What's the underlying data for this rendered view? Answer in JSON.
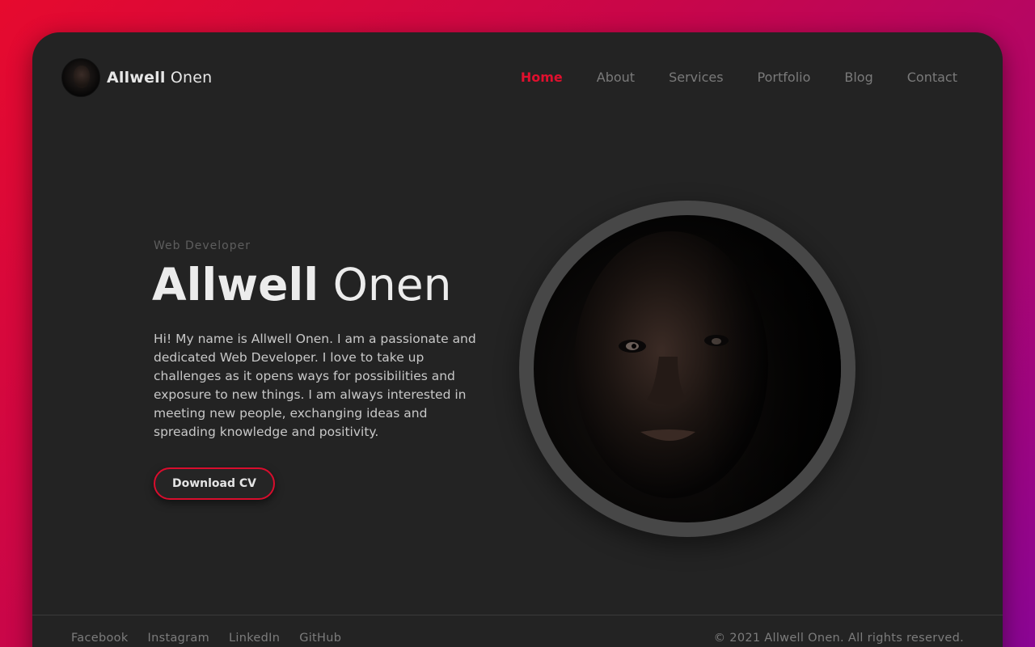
{
  "brand": {
    "first": "Allwell",
    "last": "Onen"
  },
  "nav": {
    "items": [
      {
        "label": "Home",
        "active": true
      },
      {
        "label": "About",
        "active": false
      },
      {
        "label": "Services",
        "active": false
      },
      {
        "label": "Portfolio",
        "active": false
      },
      {
        "label": "Blog",
        "active": false
      },
      {
        "label": "Contact",
        "active": false
      }
    ]
  },
  "hero": {
    "subtitle": "Web Developer",
    "name_first": "Allwell",
    "name_last": "Onen",
    "bio": "Hi! My name is Allwell Onen. I am a passionate and dedicated Web Developer. I love to take up challenges as it opens ways for possibilities and exposure to new things. I am always interested in meeting new people, exchanging ideas and spreading knowledge and positivity.",
    "cta_label": "Download CV"
  },
  "footer": {
    "social": [
      "Facebook",
      "Instagram",
      "LinkedIn",
      "GitHub"
    ],
    "copyright": "© 2021 Allwell Onen. All rights reserved."
  },
  "colors": {
    "accent": "#e0102e",
    "card_bg": "#232323",
    "gradient_start": "#e60a2e",
    "gradient_end": "#8a0594"
  },
  "icons": {
    "logo_avatar": "avatar-image",
    "portrait": "profile-photo"
  }
}
